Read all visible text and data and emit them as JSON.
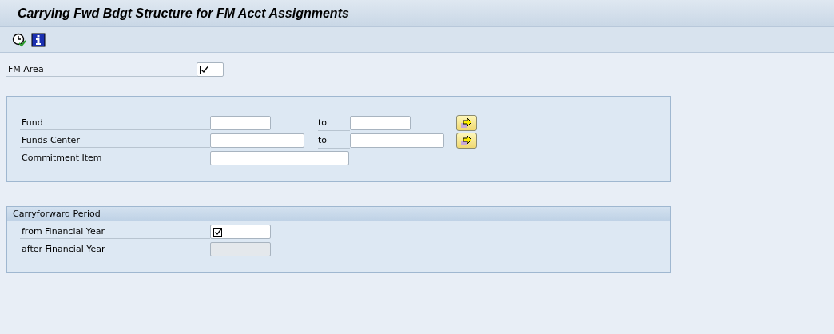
{
  "window": {
    "title": "Carrying Fwd Bdgt Structure for FM Acct Assignments"
  },
  "toolbar": [
    {
      "kind": "execute"
    },
    {
      "kind": "info"
    }
  ],
  "fm_area": {
    "label": "FM Area",
    "required": true,
    "disabled": false
  },
  "selection": {
    "rows": [
      {
        "label": "Fund",
        "low": {
          "required": false,
          "disabled": false
        },
        "to": "to",
        "high": {
          "required": false
        },
        "multiple": true
      },
      {
        "label": "Funds Center",
        "low": {
          "required": false,
          "disabled": false
        },
        "to": "to",
        "high": {
          "required": false
        },
        "multiple": true
      },
      {
        "label": "Commitment Item",
        "low": {
          "required": false,
          "disabled": false
        }
      }
    ]
  },
  "period": {
    "title": "Carryforward Period",
    "rows": [
      {
        "label": "from Financial Year",
        "field": {
          "required": true,
          "disabled": false
        }
      },
      {
        "label": "after Financial Year",
        "field": {
          "required": false,
          "disabled": true
        }
      }
    ]
  }
}
